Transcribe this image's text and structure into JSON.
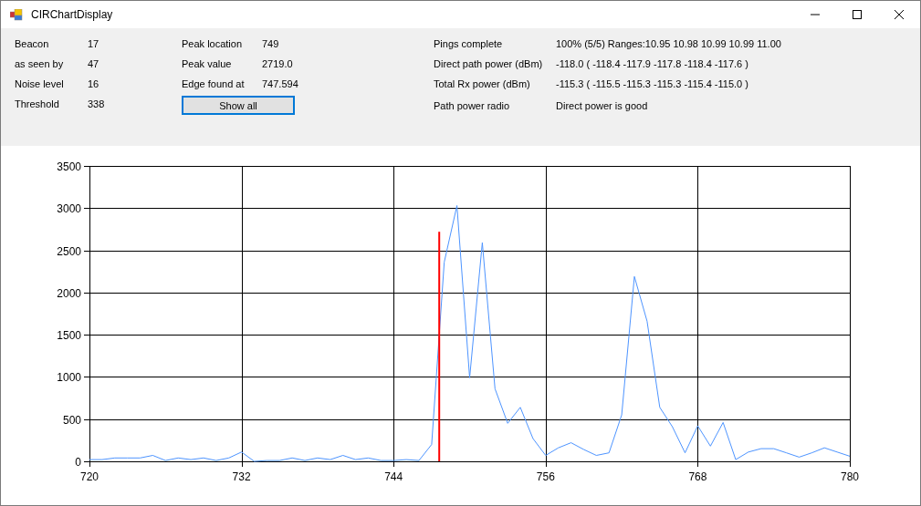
{
  "window": {
    "title": "CIRChartDisplay"
  },
  "columns": [
    {
      "fields": [
        {
          "label": "Beacon",
          "value": "17"
        },
        {
          "label": "as seen by",
          "value": "47"
        },
        {
          "label": "Noise level",
          "value": "16"
        },
        {
          "label": "Threshold",
          "value": "338"
        }
      ]
    },
    {
      "fields": [
        {
          "label": "Peak location",
          "value": "749"
        },
        {
          "label": "Peak value",
          "value": "2719.0"
        },
        {
          "label": "Edge found at",
          "value": "747.594"
        }
      ],
      "button": {
        "label": "Show all",
        "focused": true
      }
    },
    {
      "fields": [
        {
          "label": "Pings complete",
          "value": "100% (5/5) Ranges:10.95 10.98 10.99 10.99 11.00"
        },
        {
          "label": "Direct path power (dBm)",
          "value": "-118.0 ( -118.4 -117.9 -117.8 -118.4 -117.6 )"
        },
        {
          "label": "Total Rx power (dBm)",
          "value": "-115.3 ( -115.5 -115.3 -115.3 -115.4 -115.0 )"
        },
        {
          "label": "Path power radio",
          "value": "Direct power is good"
        }
      ]
    }
  ],
  "chart_data": {
    "type": "line",
    "x": [
      720,
      721,
      722,
      723,
      724,
      725,
      726,
      727,
      728,
      729,
      730,
      731,
      732,
      733,
      734,
      735,
      736,
      737,
      738,
      739,
      740,
      741,
      742,
      743,
      744,
      745,
      746,
      747,
      748,
      749,
      750,
      751,
      752,
      753,
      754,
      755,
      756,
      757,
      758,
      759,
      760,
      761,
      762,
      763,
      764,
      765,
      766,
      767,
      768,
      769,
      770,
      771,
      772,
      773,
      774,
      775,
      776,
      777,
      778,
      779,
      780
    ],
    "series": [
      {
        "color": "#4d94ff",
        "values": [
          20,
          20,
          40,
          40,
          40,
          70,
          10,
          40,
          20,
          40,
          10,
          40,
          110,
          0,
          10,
          10,
          40,
          10,
          40,
          20,
          70,
          20,
          40,
          10,
          10,
          20,
          10,
          200,
          2360,
          3030,
          990,
          2590,
          860,
          450,
          640,
          270,
          70,
          160,
          220,
          140,
          70,
          100,
          550,
          2190,
          1660,
          640,
          410,
          100,
          420,
          180,
          460,
          20,
          110,
          150,
          150,
          100,
          50,
          100,
          160,
          110,
          60
        ]
      },
      {
        "color": "#ff0000",
        "x": [
          747.6,
          747.6
        ],
        "values": [
          0,
          2720
        ]
      }
    ],
    "grid": true,
    "xlim": [
      720,
      780
    ],
    "ylim": [
      0,
      3500
    ],
    "xticks": [
      720,
      732,
      744,
      756,
      768,
      780
    ],
    "yticks": [
      0,
      500,
      1000,
      1500,
      2000,
      2500,
      3000,
      3500
    ]
  }
}
